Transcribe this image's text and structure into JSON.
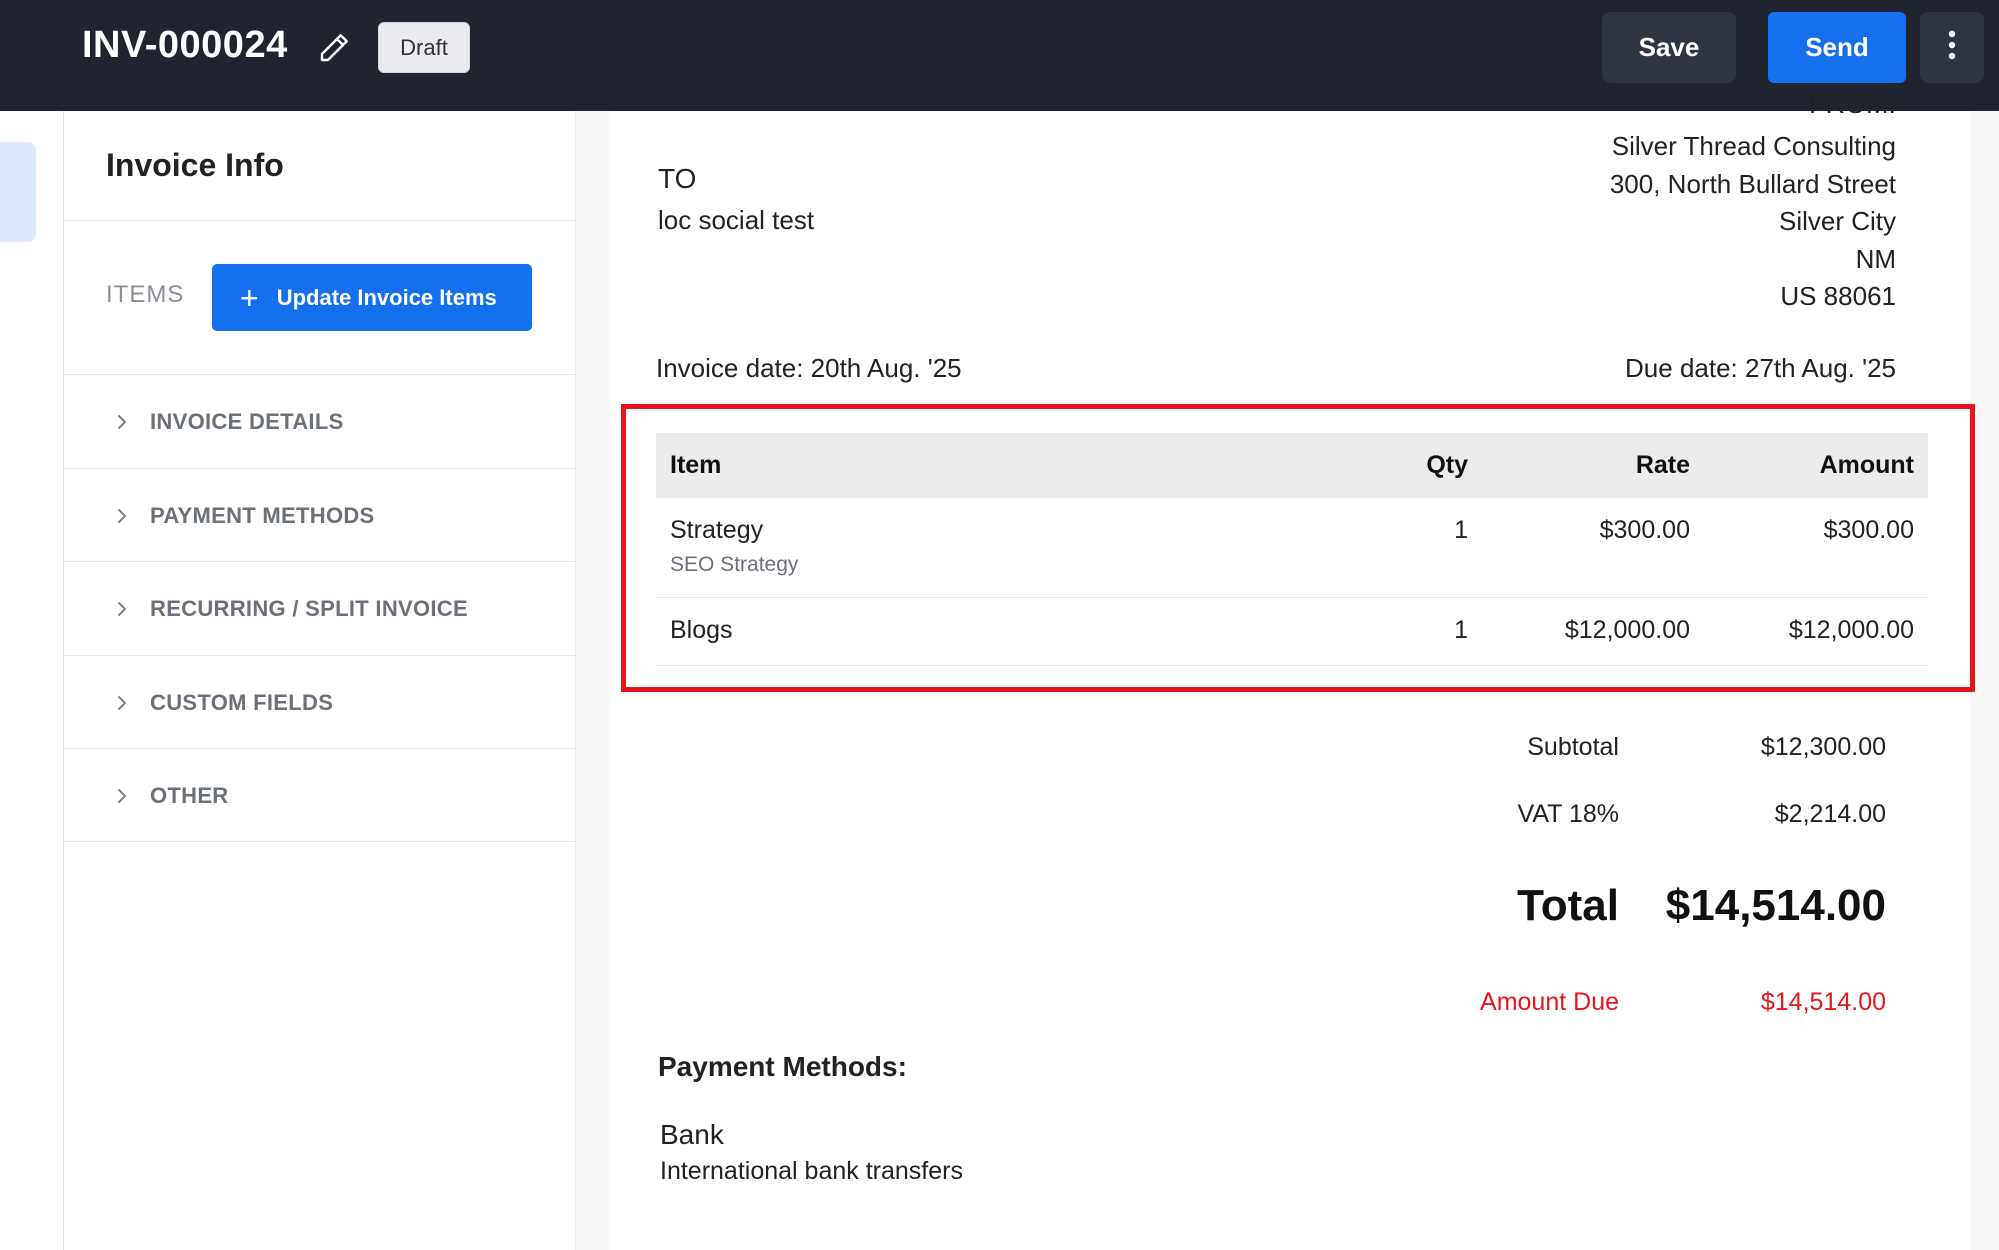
{
  "header": {
    "invoice_number": "INV-000024",
    "status_badge": "Draft",
    "save_label": "Save",
    "send_label": "Send"
  },
  "sidebar": {
    "title": "Invoice Info",
    "items_label": "ITEMS",
    "update_items_label": "Update Invoice Items",
    "sections": [
      "INVOICE DETAILS",
      "PAYMENT METHODS",
      "RECURRING / SPLIT INVOICE",
      "CUSTOM FIELDS",
      "OTHER"
    ]
  },
  "invoice": {
    "to_label": "TO",
    "to_name": "loc social test",
    "from_label": "FROM:",
    "from_address": [
      "Silver Thread Consulting",
      "300, North Bullard Street",
      "Silver City",
      "NM",
      "US 88061"
    ],
    "invoice_date": "Invoice date: 20th Aug. '25",
    "due_date": "Due date: 27th Aug. '25",
    "columns": [
      "Item",
      "Qty",
      "Rate",
      "Amount"
    ],
    "line_items": [
      {
        "name": "Strategy",
        "description": "SEO Strategy",
        "qty": "1",
        "rate": "$300.00",
        "amount": "$300.00"
      },
      {
        "name": "Blogs",
        "description": "",
        "qty": "1",
        "rate": "$12,000.00",
        "amount": "$12,000.00"
      }
    ],
    "subtotal_label": "Subtotal",
    "subtotal": "$12,300.00",
    "tax_label": "VAT 18%",
    "tax": "$2,214.00",
    "total_label": "Total",
    "total": "$14,514.00",
    "amount_due_label": "Amount Due",
    "amount_due": "$14,514.00",
    "payment_methods_title": "Payment Methods:",
    "payment_method_name": "Bank",
    "payment_method_desc": "International bank transfers"
  },
  "colors": {
    "accent": "#1570ef",
    "topbar": "#1f242e",
    "highlight": "#e8131b",
    "due": "#e8131b"
  }
}
